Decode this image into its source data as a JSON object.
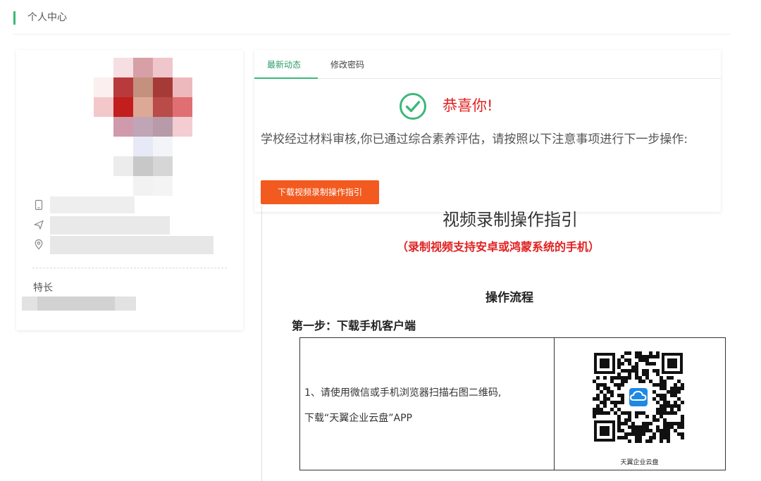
{
  "page": {
    "title": "个人中心"
  },
  "profile": {
    "skill_label": "特长",
    "icons": [
      "phone-icon",
      "send-icon",
      "location-icon"
    ]
  },
  "tabs": [
    {
      "label": "最新动态",
      "active": true
    },
    {
      "label": "修改密码",
      "active": false
    }
  ],
  "status": {
    "title": "恭喜你!",
    "message": "学校经过材料审核,你已通过综合素养评估，请按照以下注意事项进行下一步操作:",
    "button_label": "下载视频录制操作指引"
  },
  "guide": {
    "title": "视频录制操作指引",
    "subtitle": "（录制视频支持安卓或鸿蒙系统的手机）",
    "process_title": "操作流程",
    "step1_title": "第一步：下载手机客户端",
    "step1_line1": "1、请使用微信或手机浏览器扫描右图二维码,",
    "step1_line2": "下载“天翼企业云盘”APP",
    "qr_label": "天翼企业云盘"
  },
  "colors": {
    "accent_green": "#3cb878",
    "button_orange": "#f25a1f",
    "alert_red": "#e12020"
  }
}
